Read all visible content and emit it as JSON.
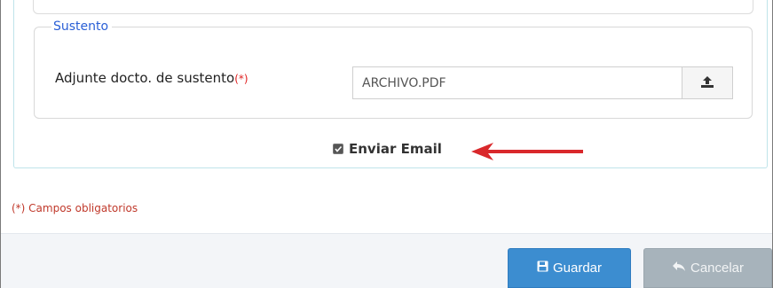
{
  "fieldset": {
    "legend": "Sustento",
    "label": "Adjunte docto. de sustento",
    "required_mark": "(*)",
    "file_value": "ARCHIVO.PDF"
  },
  "email": {
    "label": "Enviar Email",
    "checked": true
  },
  "note": "(*) Campos obligatorios",
  "buttons": {
    "save_label": "Guardar",
    "cancel_label": "Cancelar"
  },
  "icons": {
    "upload": "upload-icon",
    "save": "floppy-disk-icon",
    "cancel": "reply-arrow-icon",
    "annotation": "red-arrow-icon"
  },
  "colors": {
    "legend": "#2a5fd6",
    "required": "#e02020",
    "note": "#c0392b",
    "save_button": "#3c8dd0",
    "cancel_button": "#a7b3bb",
    "annotation_arrow": "#d9282b"
  }
}
